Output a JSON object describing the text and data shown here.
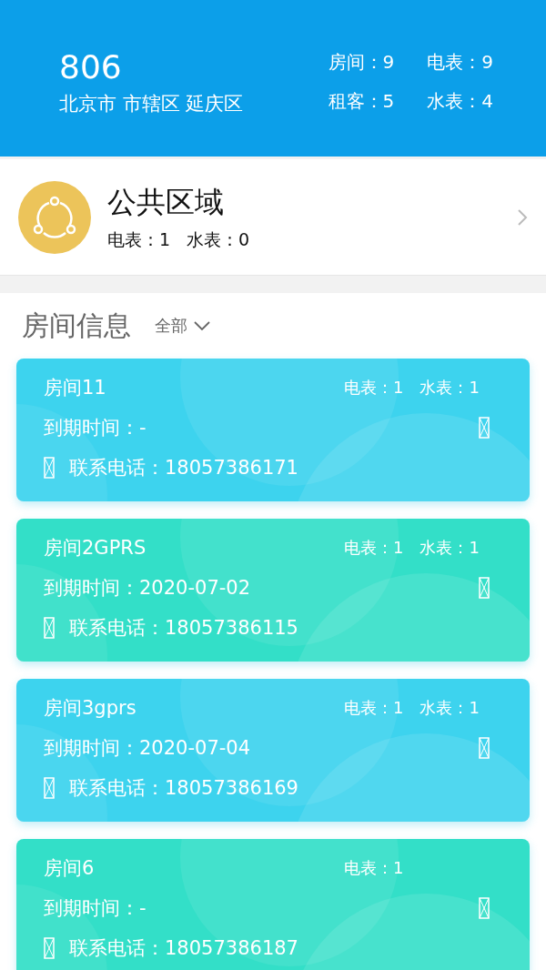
{
  "header": {
    "title": "806",
    "location": "北京市 市辖区 延庆区",
    "stats": [
      "房间：9",
      "电表：9",
      "租客：5",
      "水表：4"
    ]
  },
  "public_area": {
    "title": "公共区域",
    "meters": [
      "电表：1",
      "水表：0"
    ]
  },
  "rooms_section": {
    "title": "房间信息",
    "filter": "全部"
  },
  "rooms": [
    {
      "name": "房间11",
      "meters": [
        "电表：1",
        "水表：1"
      ],
      "expiry": "到期时间：-",
      "phone": "联系电话：18057386171",
      "color": "#3dd3ee"
    },
    {
      "name": "房间2GPRS",
      "meters": [
        "电表：1",
        "水表：1"
      ],
      "expiry": "到期时间：2020-07-02",
      "phone": "联系电话：18057386115",
      "color": "#33dfc8"
    },
    {
      "name": "房间3gprs",
      "meters": [
        "电表：1",
        "水表：1"
      ],
      "expiry": "到期时间：2020-07-04",
      "phone": "联系电话：18057386169",
      "color": "#3dd3ee"
    },
    {
      "name": "房间6",
      "meters": [
        "电表：1"
      ],
      "expiry": "到期时间：-",
      "phone": "联系电话：18057386187",
      "color": "#33dfc8"
    }
  ]
}
